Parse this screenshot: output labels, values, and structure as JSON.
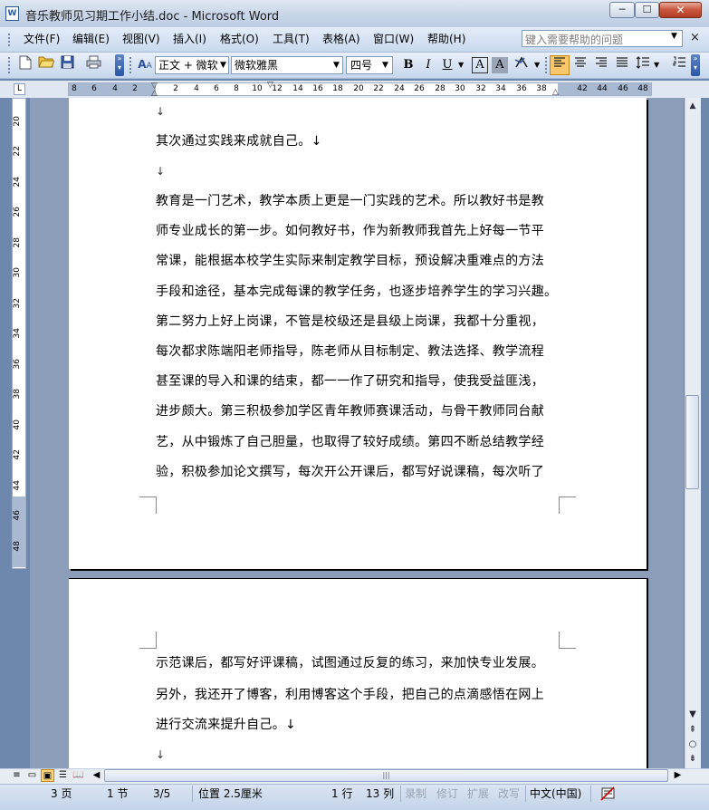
{
  "window": {
    "icon": "W",
    "title": "音乐教师见习期工作小结.doc - Microsoft Word",
    "min_label": "─",
    "max_label": "☐",
    "close_label": "✕"
  },
  "menu": {
    "items": [
      "文件(F)",
      "编辑(E)",
      "视图(V)",
      "插入(I)",
      "格式(O)",
      "工具(T)",
      "表格(A)",
      "窗口(W)",
      "帮助(H)"
    ],
    "help_placeholder": "键入需要帮助的问题",
    "close_doc": "×"
  },
  "toolbar": {
    "style_value": "正文 + 微软",
    "font_value": "微软雅黑",
    "size_value": "四号",
    "bold": "B",
    "italic": "I",
    "underline": "U",
    "char_border": "A",
    "char_shading": "A",
    "icons": [
      "new-document-icon",
      "open-folder-icon",
      "save-icon",
      "print-icon",
      "styles-icon",
      "highlight-icon",
      "align-left-icon",
      "align-center-icon",
      "align-right-icon",
      "justify-icon",
      "line-spacing-icon",
      "numbered-list-icon"
    ]
  },
  "ruler": {
    "h_ticks": [
      "8",
      "6",
      "4",
      "2",
      "2",
      "4",
      "6",
      "8",
      "10",
      "12",
      "14",
      "16",
      "18",
      "20",
      "22",
      "24",
      "26",
      "28",
      "30",
      "32",
      "34",
      "36",
      "38",
      "42",
      "44",
      "46",
      "48"
    ],
    "v_ticks": [
      "20",
      "22",
      "24",
      "26",
      "28",
      "30",
      "32",
      "34",
      "36",
      "38",
      "40",
      "42",
      "44",
      "46",
      "48"
    ],
    "corner": "L"
  },
  "document": {
    "page1_lines": [
      "↓",
      "其次通过实践来成就自己。↓",
      "↓",
      "教育是一门艺术，教学本质上更是一门实践的艺术。所以教好书是教",
      "师专业成长的第一步。如何教好书，作为新教师我首先上好每一节平",
      "常课，能根据本校学生实际来制定教学目标，预设解决重难点的方法",
      "手段和途径，基本完成每课的教学任务，也逐步培养学生的学习兴趣。",
      "第二努力上好上岗课，不管是校级还是县级上岗课，我都十分重视，",
      "每次都求陈端阳老师指导，陈老师从目标制定、教法选择、教学流程",
      "甚至课的导入和课的结束，都一一作了研究和指导，使我受益匪浅，",
      "进步颇大。第三积极参加学区青年教师赛课活动，与骨干教师同台献",
      "艺，从中锻炼了自己胆量，也取得了较好成绩。第四不断总结教学经",
      "验，积极参加论文撰写，每次开公开课后，都写好说课稿，每次听了"
    ],
    "page2_lines": [
      "示范课后，都写好评课稿，试图通过反复的练习，来加快专业发展。",
      "另外，我还开了博客，利用博客这个手段，把自己的点滴感悟在网上",
      "进行交流来提升自己。↓",
      "↓"
    ]
  },
  "scrollbar": {
    "up": "▲",
    "down": "▼",
    "prev_page": "⇞",
    "select_browse": "○",
    "next_page": "⇟",
    "left": "◀",
    "right": "▶",
    "grip": "|||"
  },
  "status": {
    "page": "3 页",
    "section": "1 节",
    "page_of": "3/5",
    "position": "位置 2.5厘米",
    "line": "1 行",
    "column": "13 列",
    "rec": "录制",
    "trk": "修订",
    "ext": "扩展",
    "ovr": "改写",
    "language": "中文(中国)",
    "spelling_icon": "spelling-check-icon"
  },
  "colors": {
    "titlebar": "#c8d6e8",
    "doc_background": "#8c9db9",
    "close_button": "#c8553c"
  }
}
